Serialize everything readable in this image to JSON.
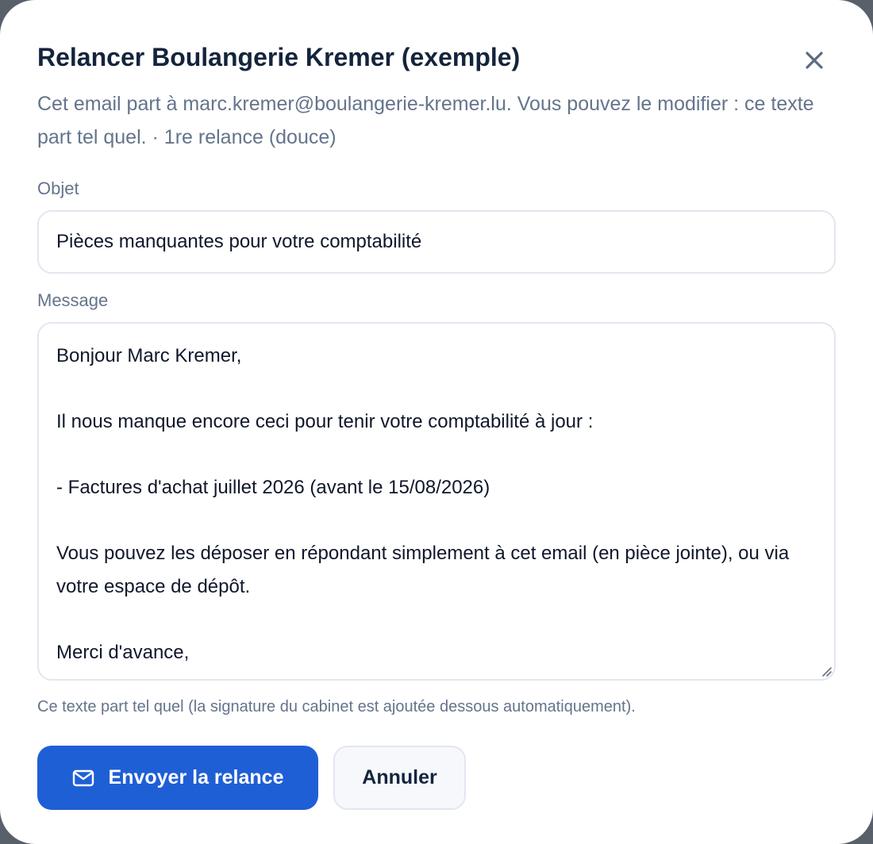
{
  "dialog": {
    "title": "Relancer Boulangerie Kremer (exemple)",
    "subtitle": "Cet email part à marc.kremer@boulangerie-kremer.lu. Vous pouvez le modifier : ce texte part tel quel. · 1re relance (douce)",
    "close_icon": "close-icon"
  },
  "form": {
    "subject_label": "Objet",
    "subject_value": "Pièces manquantes pour votre comptabilité",
    "message_label": "Message",
    "message_value": "Bonjour Marc Kremer,\n\nIl nous manque encore ceci pour tenir votre comptabilité à jour :\n\n- Factures d'achat juillet 2026 (avant le 15/08/2026)\n\nVous pouvez les déposer en répondant simplement à cet email (en pièce jointe), ou via votre espace de dépôt.\n\nMerci d'avance,",
    "helper_text": "Ce texte part tel quel (la signature du cabinet est ajoutée dessous automatiquement)."
  },
  "actions": {
    "send_label": "Envoyer la relance",
    "send_icon": "mail-icon",
    "cancel_label": "Annuler"
  },
  "colors": {
    "primary": "#1f5fd6",
    "title": "#14243c",
    "muted": "#64748b",
    "border": "#e2e6ef"
  }
}
